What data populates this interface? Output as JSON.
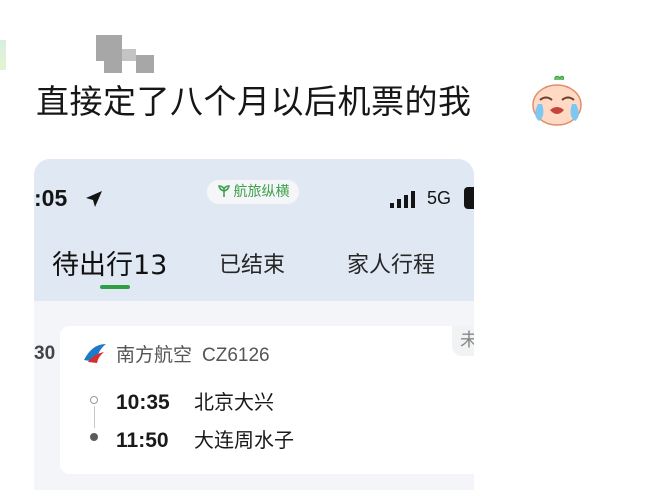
{
  "post": {
    "caption": "直接定了八个月以后机票的我"
  },
  "phone": {
    "status_bar": {
      "time": ":05",
      "brand_name": "航旅纵横",
      "network": "5G"
    },
    "tabs": [
      {
        "label": "待出行13",
        "active": true
      },
      {
        "label": "已结束",
        "active": false
      },
      {
        "label": "家人行程",
        "active": false
      }
    ],
    "cards": {
      "partial_left_text": "30"
    },
    "flight": {
      "airline": "南方航空",
      "flight_no": "CZ6126",
      "status": "未使",
      "departure": {
        "time": "10:35",
        "city": "北京大兴"
      },
      "arrival": {
        "time": "11:50",
        "city": "大连周水子"
      }
    }
  },
  "colors": {
    "accent_green": "#2ea043",
    "phone_bg": "#dfe8f3",
    "airline_blue": "#1e7ac9",
    "airline_red": "#d72d2d"
  }
}
